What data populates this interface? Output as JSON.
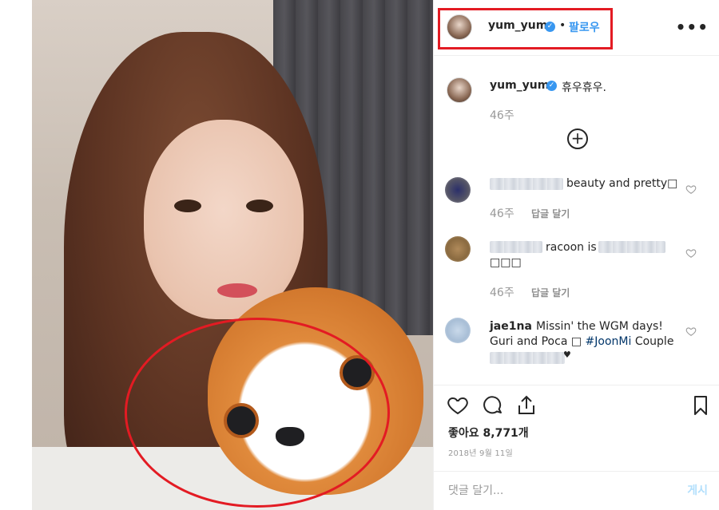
{
  "post": {
    "username": "yum_yum",
    "follow_label": "팔로우",
    "separator": "•",
    "more_icon": "more-icon",
    "caption": {
      "username": "yum_yum",
      "text": "휴우휴우.",
      "time": "46주"
    },
    "load_more_icon": "plus-circle-icon",
    "comments": [
      {
        "text": "beauty and pretty□",
        "time": "46주",
        "reply_label": "답글 달기"
      },
      {
        "text_before": "racoon is",
        "text_line2": "□□□",
        "time": "46주",
        "reply_label": "답글 달기"
      },
      {
        "username": "jae1na",
        "text": "Missin' the WGM days!",
        "text_line2_before": "Guri and Poca □ ",
        "hashtag": "#JoonMi",
        "text_line2_after": " Couple",
        "text_line3_suffix": "♥"
      }
    ],
    "likes": "좋아요 8,771개",
    "date": "2018년 9월 11일",
    "comment_placeholder": "댓글 달기...",
    "post_label": "게시"
  },
  "colors": {
    "link_blue": "#3897f0",
    "annotation_red": "#e31b23",
    "muted": "#999999"
  }
}
